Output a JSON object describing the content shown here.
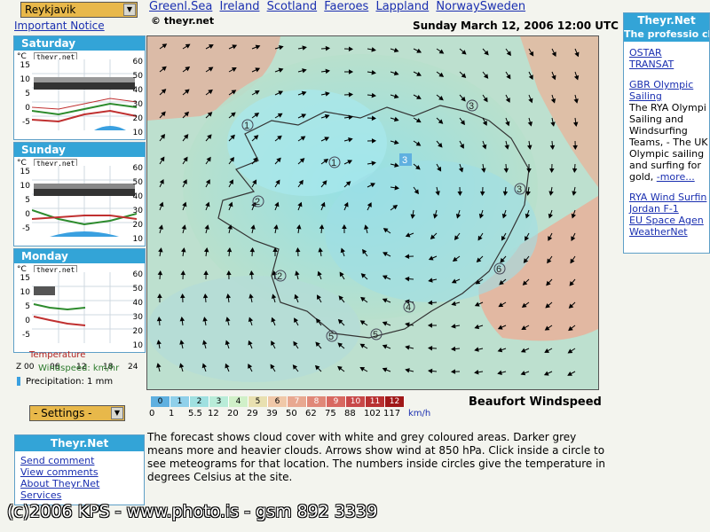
{
  "location": {
    "selected": "Reykjavik",
    "notice": "Important Notice"
  },
  "nav": {
    "links": [
      "Greenl.Sea",
      "Ireland",
      "Scotland",
      "Faeroes",
      "Lappland",
      "NorwaySweden"
    ]
  },
  "days": [
    {
      "name": "Saturday"
    },
    {
      "name": "Sunday"
    },
    {
      "name": "Monday"
    }
  ],
  "meteogram": {
    "unit": "°C",
    "logo": "theyr.net",
    "left_ticks": [
      "15",
      "10",
      "5",
      "0",
      "-5"
    ],
    "right_ticks": [
      "60",
      "50",
      "40",
      "30",
      "20",
      "10"
    ],
    "x_ticks": [
      "Z 00",
      "06",
      "12",
      "18",
      "24"
    ]
  },
  "legend": {
    "temperature": "Temperature",
    "windspeed": "Windspeed: km/hr",
    "precip": "Precipitation: 1 mm"
  },
  "settings": {
    "label": "- Settings -"
  },
  "theyr": {
    "title": "Theyr.Net",
    "links": [
      "Send comment",
      "View comments",
      "About Theyr.Net",
      "Services"
    ]
  },
  "map": {
    "copyright": "© theyr.net",
    "datetime": "Sunday March 12, 2006 12:00 UTC",
    "temps": [
      "1",
      "3",
      "1",
      "3",
      "2",
      "2",
      "4",
      "5",
      "5",
      "6",
      "3"
    ]
  },
  "scale": {
    "levels": [
      "0",
      "1",
      "2",
      "3",
      "4",
      "5",
      "6",
      "7",
      "8",
      "9",
      "10",
      "11",
      "12"
    ],
    "speeds": [
      "0",
      "1",
      "5.5",
      "12",
      "20",
      "29",
      "39",
      "50",
      "62",
      "75",
      "88",
      "102",
      "117"
    ],
    "unit": "km/h",
    "title": "Beaufort Windspeed",
    "colors": [
      "#5fb0e0",
      "#8fd0ea",
      "#9fe0e0",
      "#b8ecd8",
      "#d0f0c8",
      "#e8e0b0",
      "#f0c8a8",
      "#e8a890",
      "#e08878",
      "#d86860",
      "#c84848",
      "#b83030",
      "#a01818"
    ]
  },
  "description": "The forecast shows cloud cover with white and grey coloured areas. Darker grey means more and heavier clouds. Arrows show wind at 850 hPa. Click inside a circle to see meteograms for that location. The numbers inside circles give the temperature in degrees Celsius at the site.",
  "ad": {
    "title": "Theyr.Net",
    "subtitle": "The professio choice of:",
    "links": [
      "OSTAR",
      "TRANSAT",
      "GBR Olympic",
      "Sailing"
    ],
    "text": [
      "The RYA Olympi",
      "Sailing and",
      "Windsurfing",
      "Teams, - The UK",
      "Olympic sailing",
      "and surfing for",
      "gold,"
    ],
    "more": "-more...",
    "links2": [
      "RYA Wind Surfin",
      "Jordan F-1",
      "EU Space Agen",
      "WeatherNet"
    ]
  },
  "watermark": "(c)2006 KPS - www.photo.is - gsm 892 3339"
}
